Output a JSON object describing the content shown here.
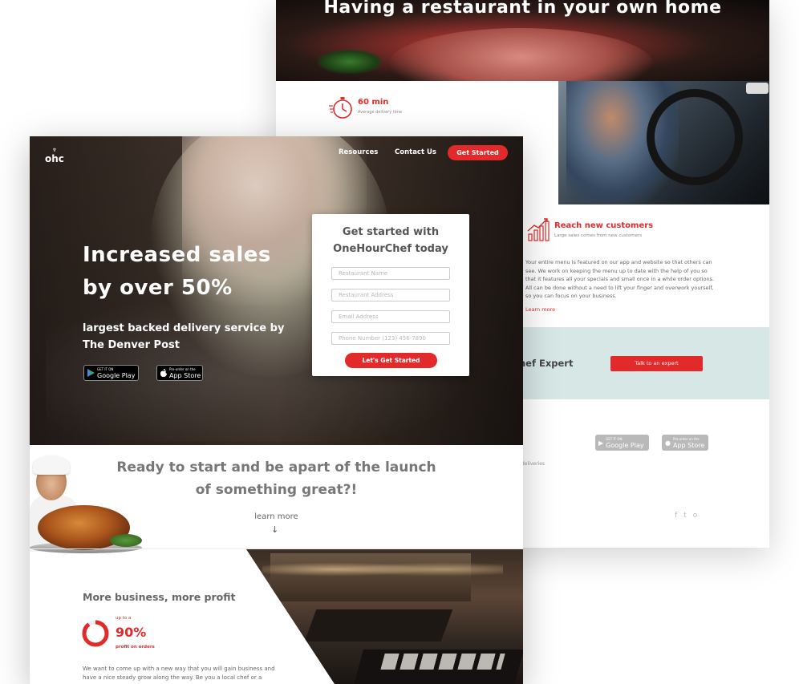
{
  "back_page": {
    "hero_title": "Having a restaurant in your own home",
    "delivery": {
      "value": "60 min",
      "label": "Average delivery time"
    },
    "reach": {
      "title": "Reach new customers",
      "subtitle": "Large sales comes from new customers",
      "body": "Your entire menu is featured on our app and website so that others can see. We work on keeping the menu up to date with the help of you so that it features all your specials and small once in a while order options. All can be done without a need to lift your finger and overwork yourself, so you can focus on your business.",
      "learn_more": "Learn more"
    },
    "expert": {
      "label": "hef Expert",
      "button": "Talk to an expert"
    },
    "deliveries_text": "deliveries",
    "stores": {
      "google_small": "GET IT ON",
      "google_big": "Google Play",
      "apple_small": "Pre-order on the",
      "apple_big": "App Store"
    },
    "social": [
      "f",
      "t",
      "o"
    ]
  },
  "front_page": {
    "logo": {
      "hat": "♆",
      "text": "ohc"
    },
    "nav": {
      "resources": "Resources",
      "contact": "Contact Us",
      "cta": "Get Started"
    },
    "hero": {
      "title": "Increased sales by over 50%",
      "subtitle": "largest backed delivery service by The Denver Post"
    },
    "stores": {
      "google_small": "GET IT ON",
      "google_big": "Google Play",
      "apple_small": "Pre-order on the",
      "apple_big": "App Store"
    },
    "signup": {
      "title": "Get started with OneHourChef today",
      "restaurant_name_placeholder": "Restaurant Name",
      "restaurant_address_placeholder": "Restaurant Address",
      "email_placeholder": "Email Address",
      "phone_placeholder": "Phone Number (123) 456-7890",
      "button": "Let's Get Started"
    },
    "cta": {
      "title": "Ready to start and be apart of the launch of something great?!",
      "learn_more": "learn more",
      "arrow": "↓"
    },
    "profit": {
      "title": "More business, more profit",
      "up_to": "up to a",
      "percent": "90%",
      "percent_value": 0.9,
      "label": "profit on orders",
      "body": "We want to come up with a new way that you will gain business and have a nice steady grow along the way. Be you a local chef or a"
    },
    "colors": {
      "accent": "#e22a2a",
      "muted_text": "#666666",
      "expert_band": "#d7e7e6"
    }
  }
}
